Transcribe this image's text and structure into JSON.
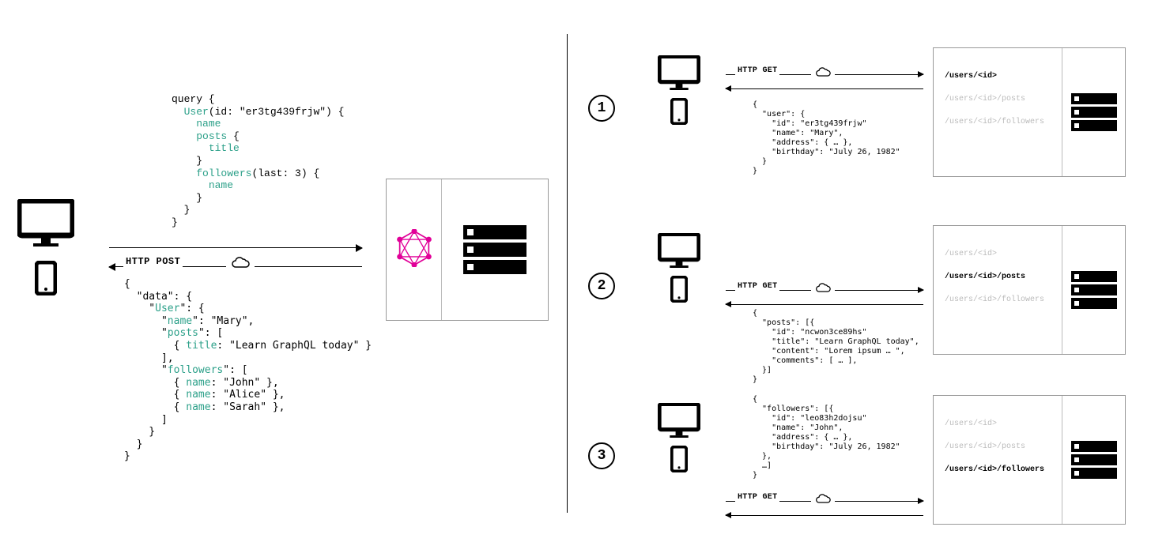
{
  "left": {
    "http_method": "HTTP POST",
    "query_lines": [
      {
        "t": "query {"
      },
      {
        "t": "  ",
        "k": "User",
        "r": "(id: \"er3tg439frjw\") {"
      },
      {
        "t": "    ",
        "k": "name"
      },
      {
        "t": "    ",
        "k": "posts",
        "r": " {"
      },
      {
        "t": "      ",
        "k": "title"
      },
      {
        "t": "    }"
      },
      {
        "t": "    ",
        "k": "followers",
        "r": "(last: 3) {"
      },
      {
        "t": "      ",
        "k": "name"
      },
      {
        "t": "    }"
      },
      {
        "t": "  }"
      },
      {
        "t": "}"
      }
    ],
    "response_lines": [
      {
        "t": "{"
      },
      {
        "t": "  \"data\": {"
      },
      {
        "t": "    \"",
        "k": "User",
        "r": "\": {"
      },
      {
        "t": "      \"",
        "k": "name",
        "r": "\": \"Mary\","
      },
      {
        "t": "      \"",
        "k": "posts",
        "r": "\": ["
      },
      {
        "t": "        { ",
        "k": "title",
        "r": ": \"Learn GraphQL today\" }"
      },
      {
        "t": "      ],"
      },
      {
        "t": "      \"",
        "k": "followers",
        "r": "\": ["
      },
      {
        "t": "        { ",
        "k": "name",
        "r": ": \"John\" },"
      },
      {
        "t": "        { ",
        "k": "name",
        "r": ": \"Alice\" },"
      },
      {
        "t": "        { ",
        "k": "name",
        "r": ": \"Sarah\" },"
      },
      {
        "t": "      ]"
      },
      {
        "t": "    }"
      },
      {
        "t": "  }"
      },
      {
        "t": "}"
      }
    ]
  },
  "right": {
    "http_method": "HTTP GET",
    "endpoints": [
      "/users/<id>",
      "/users/<id>/posts",
      "/users/<id>/followers"
    ],
    "rows": [
      {
        "num": "1",
        "active": 0,
        "json": "{\n  \"user\": {\n    \"id\": \"er3tg439frjw\"\n    \"name\": \"Mary\",\n    \"address\": { … },\n    \"birthday\": \"July 26, 1982\"\n  }\n}"
      },
      {
        "num": "2",
        "active": 1,
        "json": "{\n  \"posts\": [{\n    \"id\": \"ncwon3ce89hs\"\n    \"title\": \"Learn GraphQL today\",\n    \"content\": \"Lorem ipsum … \",\n    \"comments\": [ … ],\n  }]\n}"
      },
      {
        "num": "3",
        "active": 2,
        "json": "{\n  \"followers\": [{\n    \"id\": \"leo83h2dojsu\"\n    \"name\": \"John\",\n    \"address\": { … },\n    \"birthday\": \"July 26, 1982\"\n  },\n  …]\n}"
      }
    ]
  }
}
